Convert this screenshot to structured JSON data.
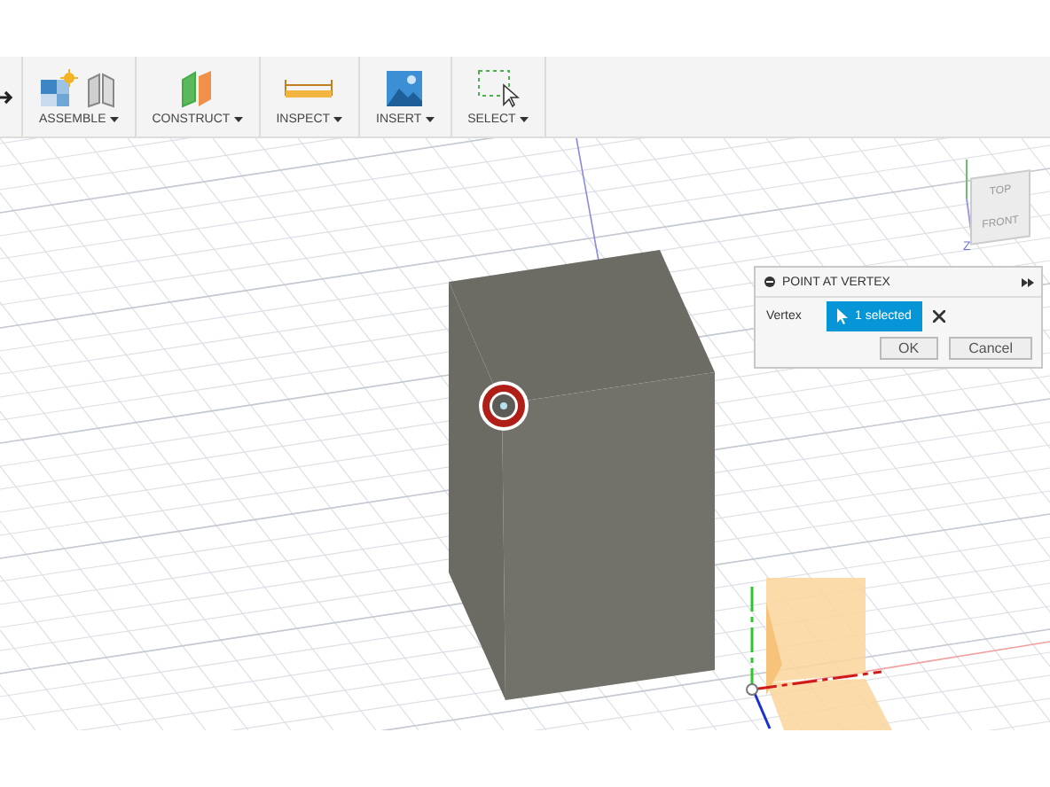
{
  "toolbar": {
    "groups": [
      {
        "icons": [
          {
            "kind": "arrow"
          }
        ]
      },
      {
        "label": "ASSEMBLE",
        "icons": [
          {
            "kind": "component"
          },
          {
            "kind": "joint"
          }
        ]
      },
      {
        "label": "CONSTRUCT",
        "icons": [
          {
            "kind": "plane"
          }
        ]
      },
      {
        "label": "INSPECT",
        "icons": [
          {
            "kind": "measure"
          }
        ]
      },
      {
        "label": "INSERT",
        "icons": [
          {
            "kind": "image"
          }
        ]
      },
      {
        "label": "SELECT",
        "icons": [
          {
            "kind": "select"
          }
        ]
      }
    ]
  },
  "view_cube": {
    "faces": [
      "TOP",
      "FRONT"
    ],
    "axis_label": "Z"
  },
  "dialog": {
    "title": "POINT AT VERTEX",
    "fields": [
      {
        "label": "Vertex",
        "value": "1 selected"
      }
    ],
    "buttons": [
      "OK",
      "Cancel"
    ]
  }
}
